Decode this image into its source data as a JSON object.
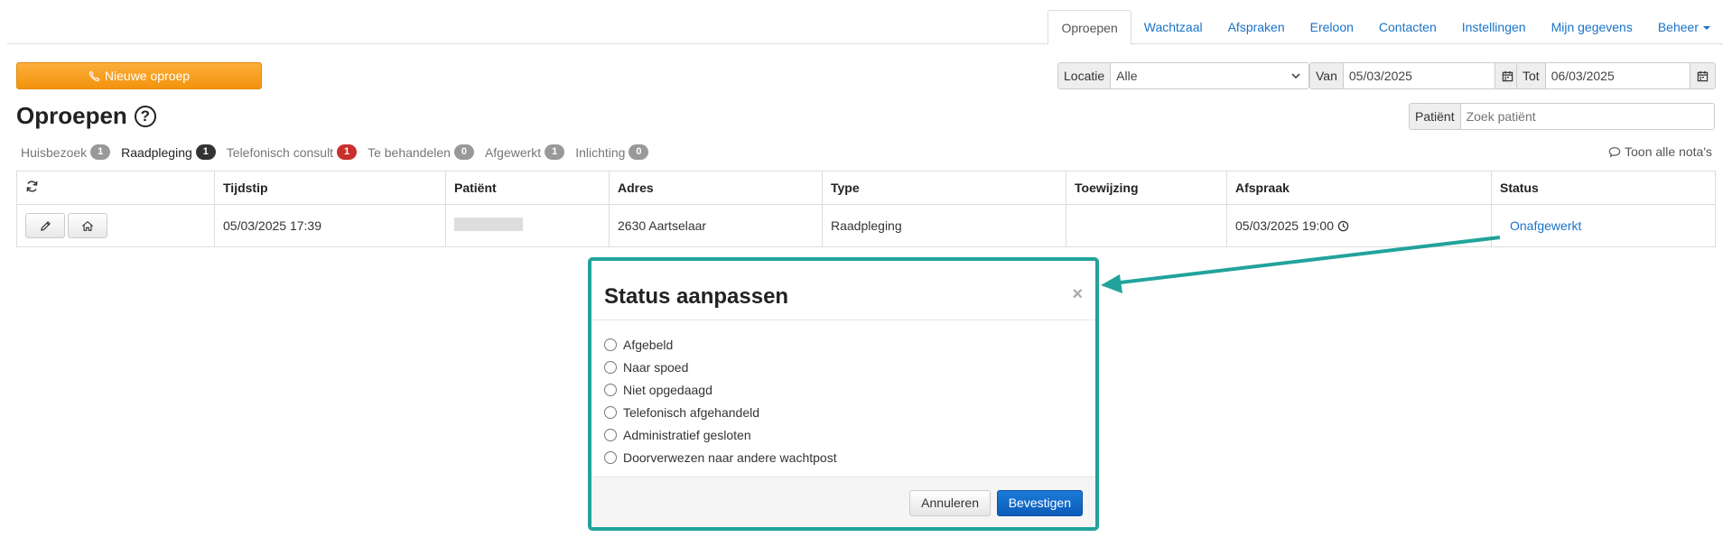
{
  "nav": {
    "tabs": [
      {
        "label": "Oproepen"
      },
      {
        "label": "Wachtzaal"
      },
      {
        "label": "Afspraken"
      },
      {
        "label": "Ereloon"
      },
      {
        "label": "Contacten"
      },
      {
        "label": "Instellingen"
      },
      {
        "label": "Mijn gegevens"
      },
      {
        "label": "Beheer"
      }
    ],
    "active_tab": "Oproepen"
  },
  "toolbar": {
    "new_call_label": "Nieuwe oproep",
    "locatie_label": "Locatie",
    "locatie_value": "Alle",
    "van_label": "Van",
    "van_value": "05/03/2025",
    "tot_label": "Tot",
    "tot_value": "06/03/2025"
  },
  "page": {
    "title": "Oproepen"
  },
  "patient_search": {
    "label": "Patiënt",
    "placeholder": "Zoek patiënt"
  },
  "filters": [
    {
      "label": "Huisbezoek",
      "count": "1"
    },
    {
      "label": "Raadpleging",
      "count": "1"
    },
    {
      "label": "Telefonisch consult",
      "count": "1"
    },
    {
      "label": "Te behandelen",
      "count": "0"
    },
    {
      "label": "Afgewerkt",
      "count": "1"
    },
    {
      "label": "Inlichting",
      "count": "0"
    }
  ],
  "notes_link": "Toon alle nota's",
  "table": {
    "columns": [
      "Tijdstip",
      "Patiënt",
      "Adres",
      "Type",
      "Toewijzing",
      "Afspraak",
      "Status"
    ],
    "rows": [
      {
        "tijdstip": "05/03/2025 17:39",
        "patient": "",
        "adres": "2630 Aartselaar",
        "type": "Raadpleging",
        "toewijzing": "",
        "afspraak": "05/03/2025 19:00",
        "status": "Onafgewerkt"
      }
    ]
  },
  "modal": {
    "title": "Status aanpassen",
    "close": "×",
    "options": [
      "Afgebeld",
      "Naar spoed",
      "Niet opgedaagd",
      "Telefonisch afgehandeld",
      "Administratief gesloten",
      "Doorverwezen naar andere wachtpost"
    ],
    "cancel_label": "Annuleren",
    "confirm_label": "Bevestigen"
  },
  "colors": {
    "accent_link": "#1a73c8",
    "orange_button": "#f5a623",
    "annotation_teal": "#21a39b",
    "confirm_blue": "#0d5cb8"
  }
}
